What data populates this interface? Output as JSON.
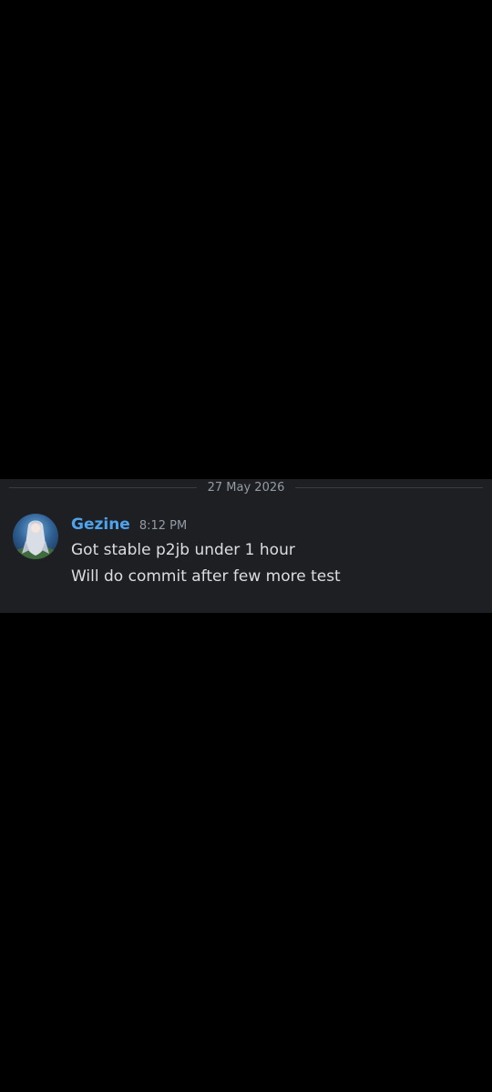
{
  "date_divider": "27 May 2026",
  "message": {
    "username": "Gezine",
    "timestamp": "8:12 PM",
    "lines": [
      "Got stable p2jb under 1 hour",
      "Will do commit after few more test"
    ],
    "avatar_icon": "user-avatar-anime-character"
  },
  "colors": {
    "background": "#000000",
    "panel": "#1e1f22",
    "username": "#4ea3ee",
    "text": "#dbdee1",
    "muted": "#949ba4"
  }
}
